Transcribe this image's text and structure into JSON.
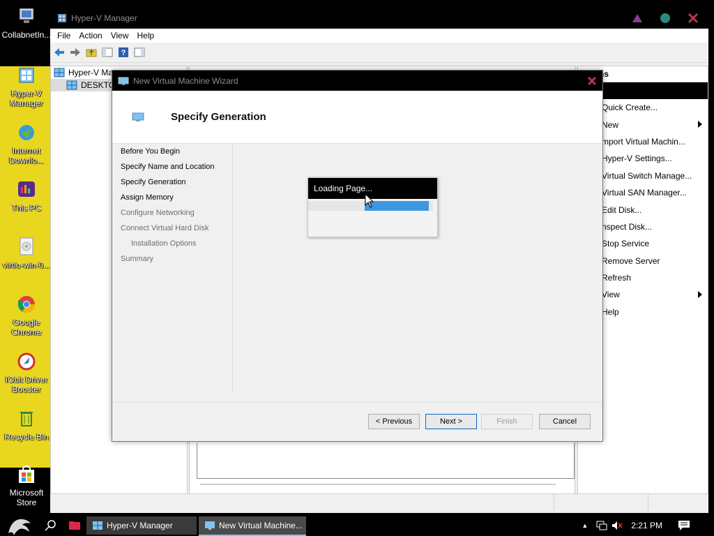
{
  "desktop": {
    "icons": [
      {
        "label": "CollabnetIn...",
        "icon": "computer-icon"
      },
      {
        "label": "Hyper-V Manager",
        "icon": "hyperv-icon"
      },
      {
        "label": "Internet Downlo...",
        "icon": "idm-icon"
      },
      {
        "label": "This PC",
        "icon": "this-pc-icon"
      },
      {
        "label": "virtio-win-0...",
        "icon": "disc-icon"
      },
      {
        "label": "Google Chrome",
        "icon": "chrome-icon"
      },
      {
        "label": "IObit Driver Booster",
        "icon": "driver-booster-icon"
      },
      {
        "label": "Recycle Bin",
        "icon": "recycle-bin-icon"
      },
      {
        "label": "Microsoft Store",
        "icon": "store-icon"
      }
    ]
  },
  "hyperv": {
    "title": "Hyper-V Manager",
    "menu": [
      "File",
      "Action",
      "View",
      "Help"
    ],
    "tree": {
      "root": "Hyper-V Ma",
      "child": "DESKTOP"
    },
    "actions_header": "ns",
    "actions": [
      {
        "label": "Quick Create...",
        "submenu": false
      },
      {
        "label": "New",
        "submenu": true
      },
      {
        "label": "mport Virtual Machin...",
        "submenu": false
      },
      {
        "label": "Hyper-V Settings...",
        "submenu": false
      },
      {
        "label": "Virtual Switch Manage...",
        "submenu": false
      },
      {
        "label": "Virtual SAN Manager...",
        "submenu": false
      },
      {
        "label": "Edit Disk...",
        "submenu": false
      },
      {
        "label": "nspect Disk...",
        "submenu": false
      },
      {
        "label": "Stop Service",
        "submenu": false
      },
      {
        "label": "Remove Server",
        "submenu": false
      },
      {
        "label": "Refresh",
        "submenu": false
      },
      {
        "label": "View",
        "submenu": true
      },
      {
        "label": "Help",
        "submenu": false
      }
    ]
  },
  "wizard": {
    "title": "New Virtual Machine Wizard",
    "page_title": "Specify Generation",
    "steps": [
      {
        "label": "Before You Begin",
        "state": "enabled",
        "indent": false
      },
      {
        "label": "Specify Name and Location",
        "state": "enabled",
        "indent": false
      },
      {
        "label": "Specify Generation",
        "state": "current",
        "indent": false
      },
      {
        "label": "Assign Memory",
        "state": "enabled",
        "indent": false
      },
      {
        "label": "Configure Networking",
        "state": "disabled",
        "indent": false
      },
      {
        "label": "Connect Virtual Hard Disk",
        "state": "disabled",
        "indent": false
      },
      {
        "label": "Installation Options",
        "state": "disabled",
        "indent": true
      },
      {
        "label": "Summary",
        "state": "disabled",
        "indent": false
      }
    ],
    "buttons": {
      "previous": "< Previous",
      "next": "Next >",
      "finish": "Finish",
      "cancel": "Cancel"
    }
  },
  "loading": {
    "title": "Loading Page...",
    "progress_start": 0.45,
    "progress_end": 1.0
  },
  "taskbar": {
    "apps": [
      "Hyper-V Manager",
      "New Virtual Machine..."
    ],
    "time": "2:21 PM"
  },
  "colors": {
    "accent": "#3d97e0",
    "titlebar": "#000000",
    "desktop_strip": "#e9d71f"
  }
}
